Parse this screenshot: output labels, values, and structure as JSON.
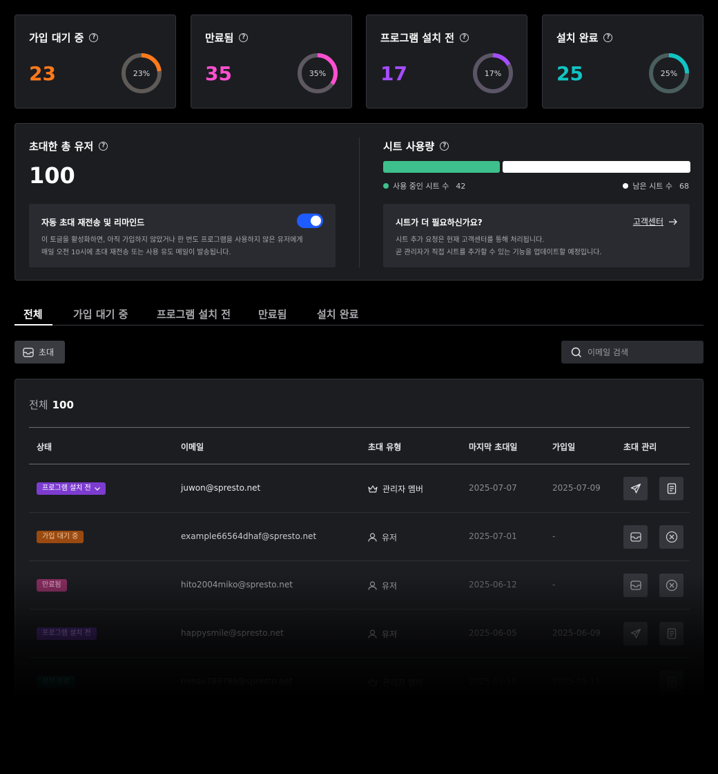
{
  "stats": [
    {
      "title": "가입 대기 중",
      "value": "23",
      "percent_label": "23%",
      "fraction": 0.23,
      "color": "#ff7a1a"
    },
    {
      "title": "만료됨",
      "value": "35",
      "percent_label": "35%",
      "fraction": 0.35,
      "color": "#ff4fd1"
    },
    {
      "title": "프로그램 설치 전",
      "value": "17",
      "percent_label": "17%",
      "fraction": 0.17,
      "color": "#a44dff"
    },
    {
      "title": "설치 완료",
      "value": "25",
      "percent_label": "25%",
      "fraction": 0.25,
      "color": "#10c4c4"
    }
  ],
  "invited": {
    "title": "초대한 총 유저",
    "total": "100"
  },
  "auto_invite": {
    "title": "자동 초대 재전송 및 리마인드",
    "desc1": "이 토글을 활성화하면, 아직 가입하지 않았거나 한 번도 프로그램을 사용하지 않은 유저에게",
    "desc2": "매일 오전 10시에 초대 재전송 또는 사용 유도 메일이 발송됩니다.",
    "enabled": true
  },
  "seats": {
    "title": "시트 사용량",
    "used_label": "사용 중인 시트 수",
    "used": "42",
    "left_label": "남은 시트 수",
    "left": "68",
    "used_color": "#3ec08c"
  },
  "more_seats": {
    "title": "시트가 더 필요하신가요?",
    "link": "고객센터",
    "desc1": "시트 추가 요청은 현재 고객센터를 통해 처리됩니다.",
    "desc2": "곧 관리자가 직접 시트를 추가할 수 있는 기능을 업데이트할 예정입니다."
  },
  "tabs": [
    "전체",
    "가입 대기 중",
    "프로그램 설치 전",
    "만료됨",
    "설치 완료"
  ],
  "invite_button": "초대",
  "search_placeholder": "이메일 검색",
  "table": {
    "total_label": "전체",
    "total": "100",
    "columns": [
      "상태",
      "이메일",
      "초대 유형",
      "마지막 초대일",
      "가입일",
      "초대 관리"
    ],
    "rows": [
      {
        "status": "프로그램 설치 전",
        "email": "juwon@spresto.net",
        "type": "관리자 멤버",
        "last_invite": "2025-07-07",
        "joined": "2025-07-09"
      },
      {
        "status": "가입 대기 중",
        "email": "example66564dhaf@spresto.net",
        "type": "유저",
        "last_invite": "2025-07-01",
        "joined": "-"
      },
      {
        "status": "만료됨",
        "email": "hito2004miko@spresto.net",
        "type": "유저",
        "last_invite": "2025-06-12",
        "joined": "-"
      },
      {
        "status": "프로그램 설치 전",
        "email": "happysmile@spresto.net",
        "type": "유저",
        "last_invite": "2025-06-05",
        "joined": "2025-06-09"
      },
      {
        "status": "설치 완료",
        "email": "minsu789789@spresto.net",
        "type": "관리자 멤버",
        "last_invite": "2025-05-10",
        "joined": "2025-05-11"
      }
    ]
  }
}
